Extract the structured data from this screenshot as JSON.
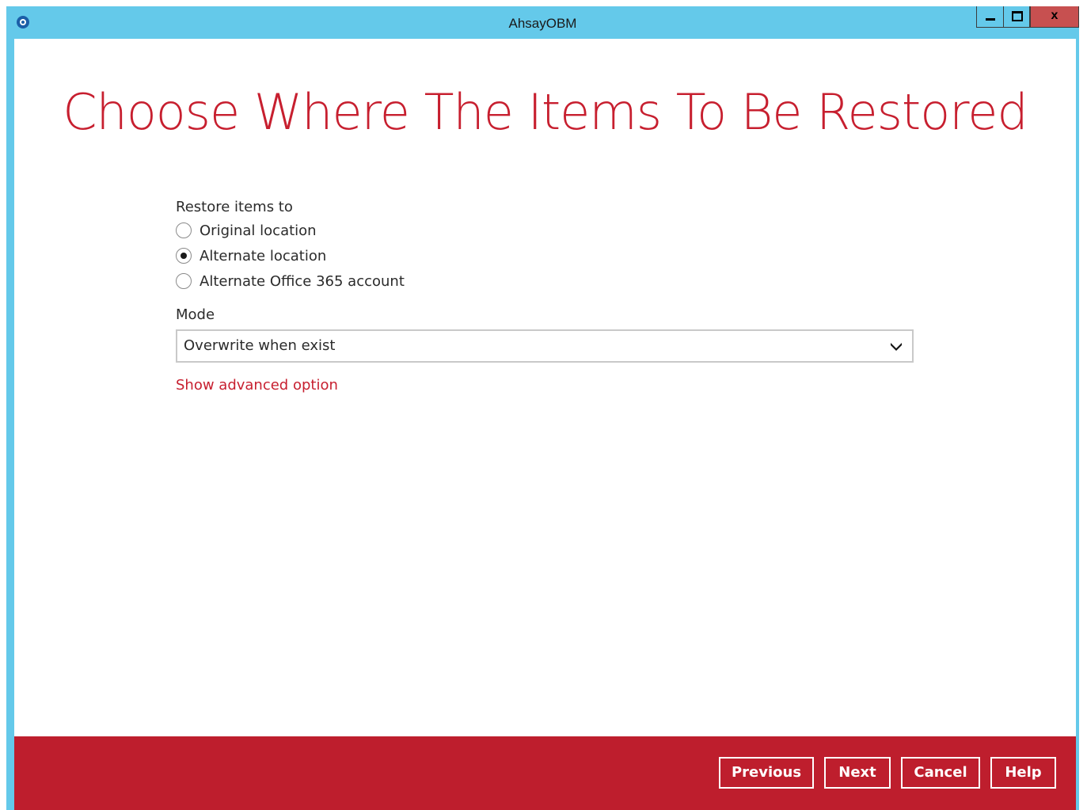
{
  "window": {
    "title": "AhsayOBM",
    "close_label": "x"
  },
  "page": {
    "title": "Choose Where The Items To Be Restored"
  },
  "restore": {
    "label": "Restore items to",
    "options": [
      {
        "label": "Original location",
        "checked": false
      },
      {
        "label": "Alternate location",
        "checked": true
      },
      {
        "label": "Alternate Office 365 account",
        "checked": false
      }
    ]
  },
  "mode": {
    "label": "Mode",
    "selected": "Overwrite when exist"
  },
  "advanced": {
    "link_label": "Show advanced option"
  },
  "footer": {
    "previous_label": "Previous",
    "next_label": "Next",
    "cancel_label": "Cancel",
    "help_label": "Help"
  },
  "colors": {
    "accent": "#c71f2f",
    "footer_bg": "#be1e2d",
    "titlebar_bg": "#64c9ea",
    "close_button_bg": "#c75050"
  },
  "icons": {
    "app": "app-logo-icon",
    "minimize": "minimize-icon",
    "maximize": "maximize-icon",
    "close": "close-icon",
    "dropdown": "chevron-down-icon"
  }
}
